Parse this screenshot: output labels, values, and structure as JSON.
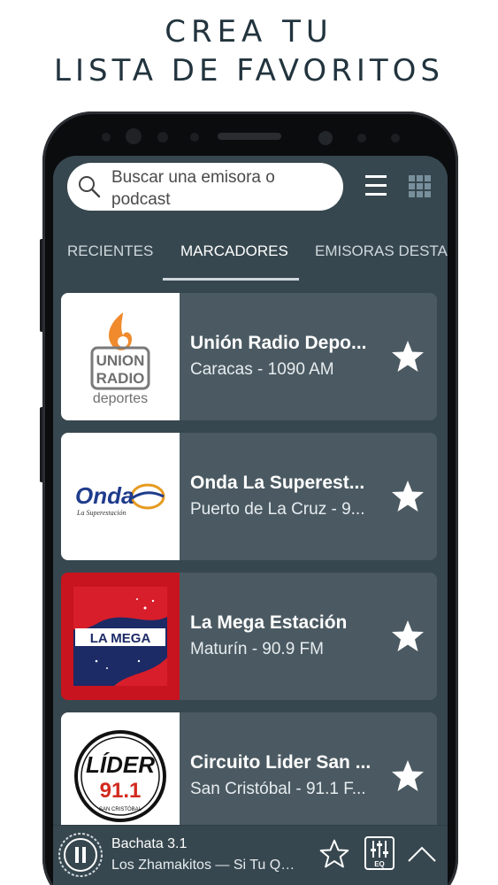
{
  "promo": {
    "line1": "CREA TU",
    "line2": "LISTA DE FAVORITOS"
  },
  "search": {
    "placeholder": "Buscar una emisora o podcast",
    "icon": "search-icon"
  },
  "toolbar": {
    "menu_icon": "hamburger-menu-icon",
    "grid_icon": "grid-view-icon"
  },
  "tabs": [
    {
      "label": "RECIENTES",
      "active": false
    },
    {
      "label": "MARCADORES",
      "active": true
    },
    {
      "label": "EMISORAS DESTAC",
      "active": false
    }
  ],
  "stations": [
    {
      "name": "Unión Radio Depo...",
      "detail": "Caracas - 1090 AM",
      "logo": "union-radio-logo",
      "favorite": true
    },
    {
      "name": "Onda La Superest...",
      "detail": "Puerto de La Cruz - 9...",
      "logo": "onda-logo",
      "favorite": true
    },
    {
      "name": "La Mega Estación",
      "detail": "Maturín - 90.9 FM",
      "logo": "la-mega-logo",
      "favorite": true
    },
    {
      "name": "Circuito Lider San ...",
      "detail": "San Cristóbal - 91.1 F...",
      "logo": "lider-logo",
      "favorite": true
    }
  ],
  "logos": {
    "union_top": "UNION",
    "union_mid": "RADIO",
    "union_bottom": "deportes",
    "onda": "Onda",
    "onda_sub": "La Superestación",
    "mega": "LA MEGA",
    "lider": "LÍDER",
    "lider_freq": "91.1",
    "lider_sub": "SAN CRISTÓBAL"
  },
  "player": {
    "title": "Bachata 3.1",
    "subtitle": "Los Zhamakitos — Si Tu Qui...",
    "eq_label": "EQ"
  },
  "colors": {
    "screen_bg": "#37474f",
    "card_bg": "#4b5a62",
    "headline": "#22343e",
    "text": "#ffffff"
  }
}
